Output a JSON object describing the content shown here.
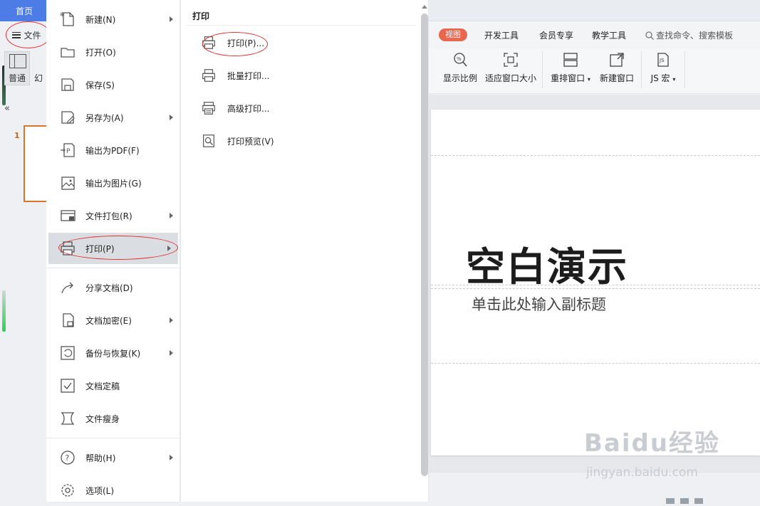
{
  "top": {
    "home_tab": "首页"
  },
  "left": {
    "file_button": "文件",
    "view_normal": "普通",
    "view_slide": "幻",
    "collapse": "«",
    "slide_number": "1"
  },
  "file_menu": {
    "items": [
      {
        "label": "新建(N)",
        "icon": "new-file-icon",
        "has_submenu": true
      },
      {
        "label": "打开(O)",
        "icon": "folder-open-icon",
        "has_submenu": false
      },
      {
        "label": "保存(S)",
        "icon": "save-icon",
        "has_submenu": false
      },
      {
        "label": "另存为(A)",
        "icon": "save-as-icon",
        "has_submenu": true
      },
      {
        "label": "输出为PDF(F)",
        "icon": "export-pdf-icon",
        "has_submenu": false
      },
      {
        "label": "输出为图片(G)",
        "icon": "export-image-icon",
        "has_submenu": false
      },
      {
        "label": "文件打包(R)",
        "icon": "package-icon",
        "has_submenu": true
      },
      {
        "label": "打印(P)",
        "icon": "printer-icon",
        "has_submenu": true,
        "active": true
      },
      {
        "label": "分享文档(D)",
        "icon": "share-icon",
        "has_submenu": false
      },
      {
        "label": "文档加密(E)",
        "icon": "encrypt-icon",
        "has_submenu": true
      },
      {
        "label": "备份与恢复(K)",
        "icon": "backup-icon",
        "has_submenu": true
      },
      {
        "label": "文档定稿",
        "icon": "finalize-icon",
        "has_submenu": false
      },
      {
        "label": "文件瘦身",
        "icon": "slim-icon",
        "has_submenu": false
      },
      {
        "label": "帮助(H)",
        "icon": "help-icon",
        "has_submenu": true
      },
      {
        "label": "选项(L)",
        "icon": "settings-icon",
        "has_submenu": false
      }
    ]
  },
  "print_submenu": {
    "title": "打印",
    "items": [
      {
        "label": "打印(P)...",
        "icon": "printer-icon"
      },
      {
        "label": "批量打印...",
        "icon": "batch-print-icon"
      },
      {
        "label": "高级打印...",
        "icon": "advanced-print-icon"
      },
      {
        "label": "打印预览(V)",
        "icon": "print-preview-icon"
      }
    ]
  },
  "ribbon": {
    "tabs": {
      "view": "视图",
      "dev": "开发工具",
      "member": "会员专享",
      "teach": "教学工具"
    },
    "search": "查找命令、搜索模板",
    "buttons": {
      "zoom": "显示比例",
      "fit": "适应窗口大小",
      "arrange": "重排窗口",
      "new_window": "新建窗口",
      "js_macro": "JS 宏"
    }
  },
  "slide": {
    "title": "空白演示",
    "subtitle": "单击此处输入副标题"
  },
  "watermark": {
    "brand": "Baidu经验",
    "url": "jingyan.baidu.com"
  },
  "colors": {
    "accent_blue": "#4d7ce6",
    "view_tab": "#e9674f",
    "annotation_red": "#e03030"
  }
}
